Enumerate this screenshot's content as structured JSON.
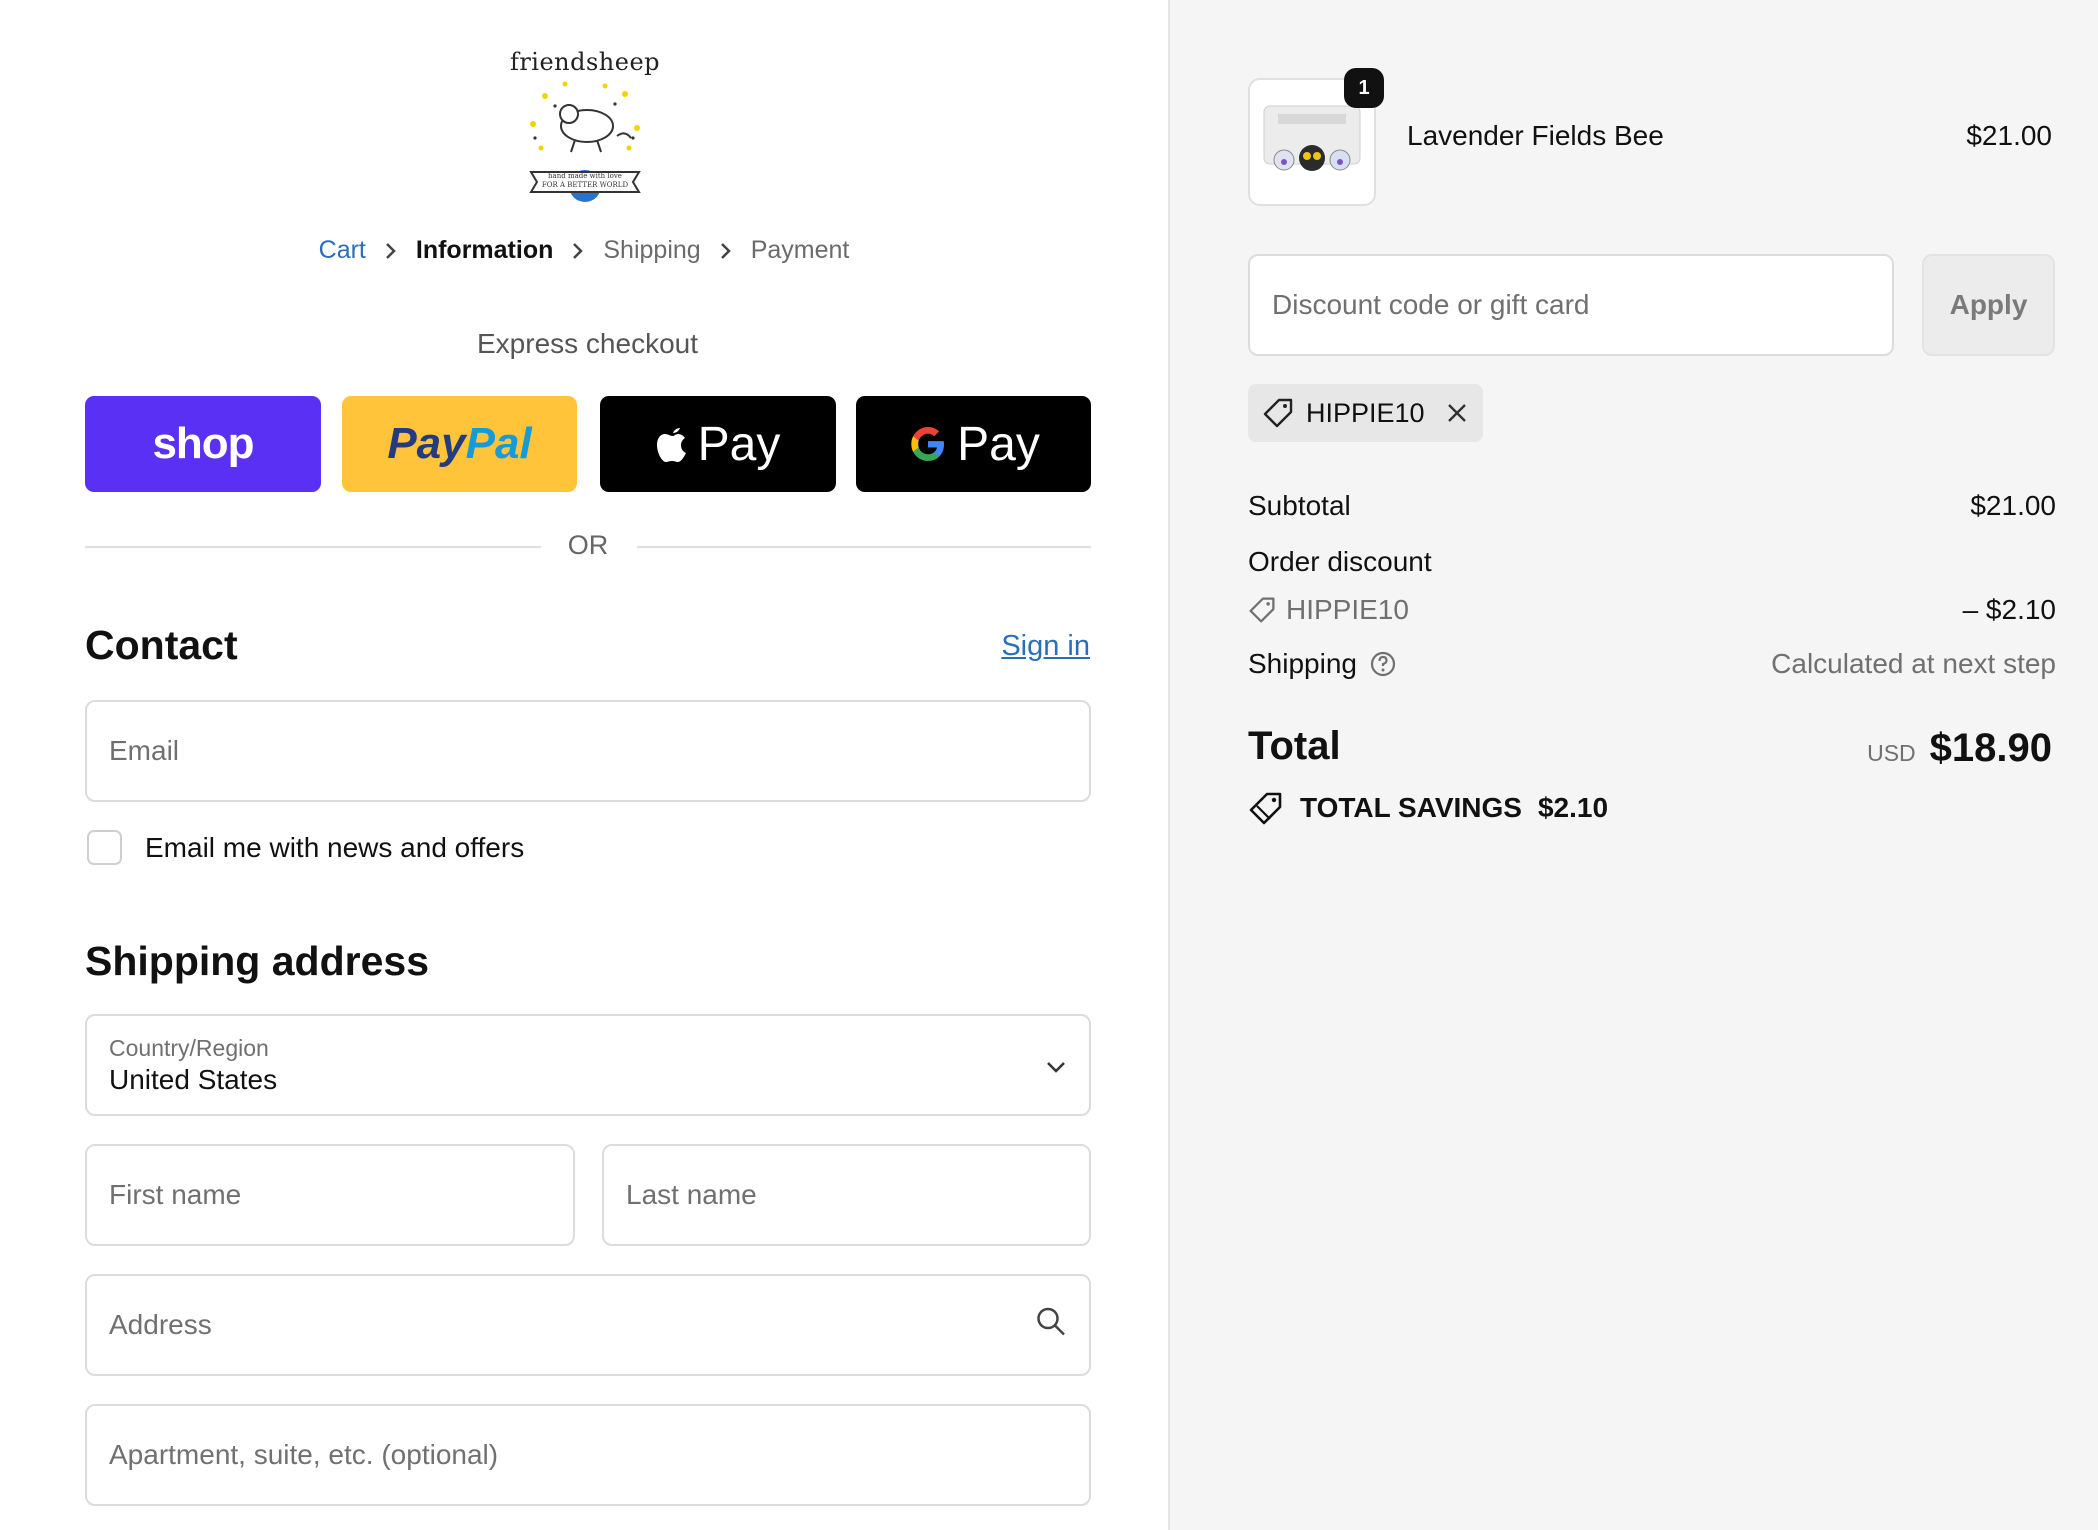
{
  "store": {
    "logo_text": "friendsheep",
    "logo_tagline": "hand made with love for a better world"
  },
  "breadcrumb": [
    {
      "label": "Cart"
    },
    {
      "label": "Information"
    },
    {
      "label": "Shipping"
    },
    {
      "label": "Payment"
    }
  ],
  "express": {
    "title": "Express checkout",
    "shop_label": "shop",
    "paypal_part1": "Pay",
    "paypal_part2": "Pal",
    "apple_label": "Pay",
    "google_label": "Pay",
    "or_label": "OR"
  },
  "contact": {
    "title": "Contact",
    "signin": "Sign in",
    "email_placeholder": "Email",
    "newsletter_label": "Email me with news and offers"
  },
  "shipping_address": {
    "title": "Shipping address",
    "country_label": "Country/Region",
    "country_value": "United States",
    "first_name_placeholder": "First name",
    "last_name_placeholder": "Last name",
    "address_placeholder": "Address",
    "apartment_placeholder": "Apartment, suite, etc. (optional)"
  },
  "order": {
    "product_name": "Lavender Fields Bee",
    "product_price": "$21.00",
    "quantity": "1",
    "discount_placeholder": "Discount code or gift card",
    "apply_label": "Apply",
    "applied_code": "HIPPIE10",
    "subtotal_label": "Subtotal",
    "subtotal_value": "$21.00",
    "order_discount_label": "Order discount",
    "discount_code": "HIPPIE10",
    "discount_value": "– $2.10",
    "shipping_label": "Shipping",
    "shipping_value": "Calculated at next step",
    "total_label": "Total",
    "currency": "USD",
    "total_value": "$18.90",
    "savings_label": "TOTAL SAVINGS",
    "savings_value": "$2.10"
  },
  "colors": {
    "shop_purple": "#5a31f4",
    "paypal_yellow": "#ffc439",
    "link_blue": "#2a6ebb",
    "sidebar_bg": "#f5f5f5"
  }
}
